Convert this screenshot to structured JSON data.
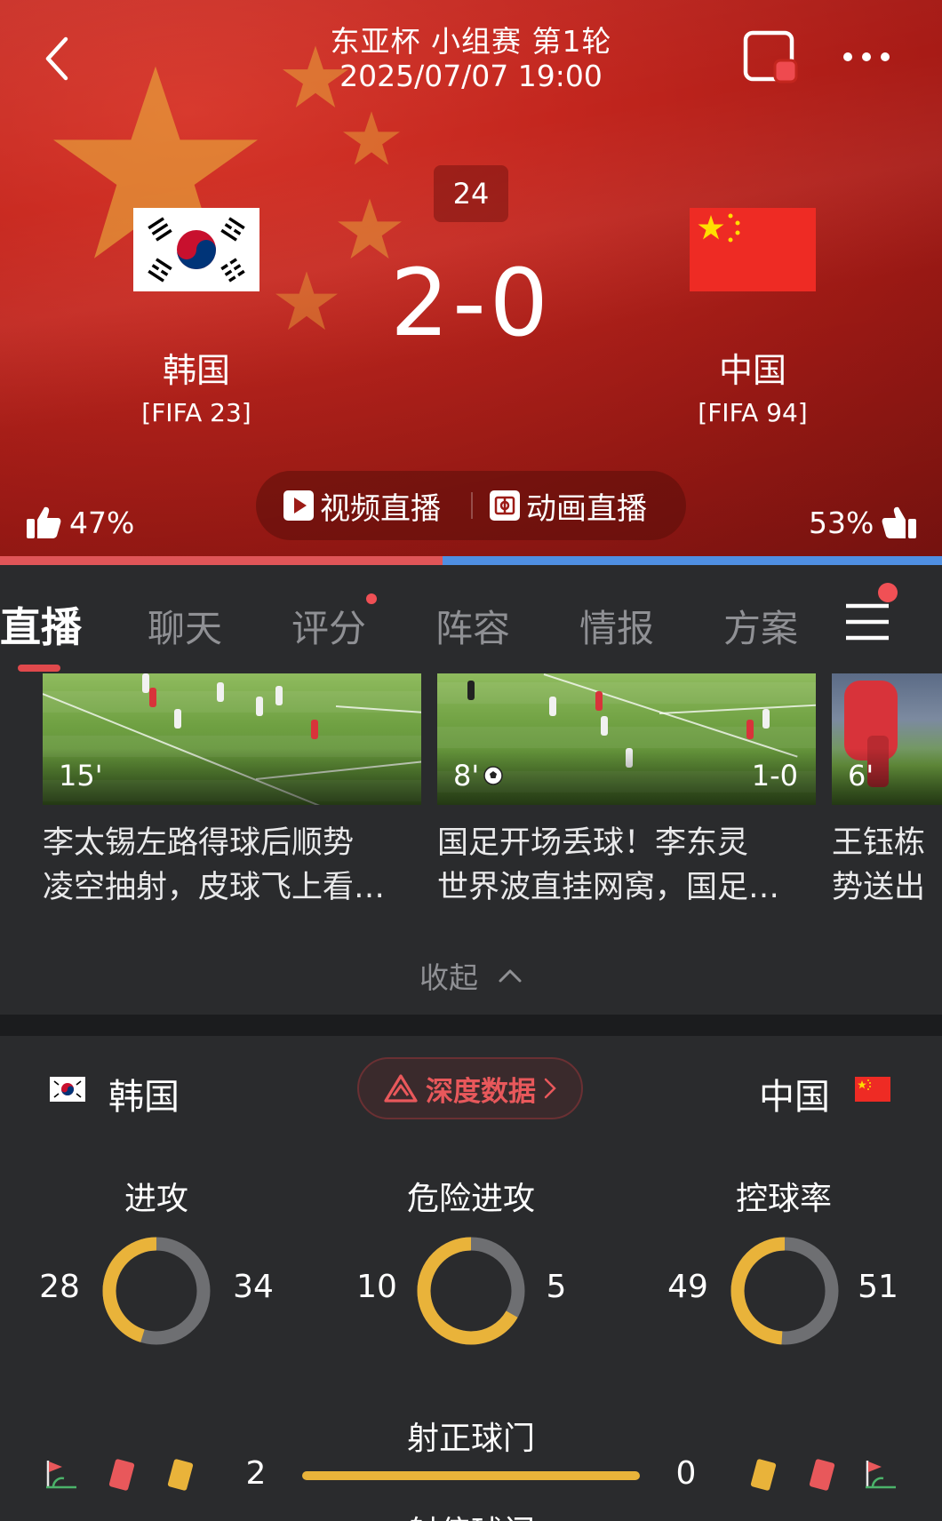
{
  "header": {
    "title": "东亚杯 小组赛 第1轮",
    "datetime": "2025/07/07 19:00",
    "minute": "24",
    "score": "2-0",
    "home": {
      "name": "韩国",
      "fifa": "[FIFA 23]",
      "support": "47%"
    },
    "away": {
      "name": "中国",
      "fifa": "[FIFA 94]",
      "support": "53%"
    },
    "live_buttons": {
      "video": "视频直播",
      "animation": "动画直播"
    },
    "support_split": 0.47,
    "colors": {
      "home_bar": "#e05558",
      "away_bar": "#4f8fe2",
      "background": "#c3261e"
    }
  },
  "tabs": [
    {
      "label": "直播",
      "active": true
    },
    {
      "label": "聊天",
      "active": false
    },
    {
      "label": "评分",
      "active": false,
      "dot": true
    },
    {
      "label": "阵容",
      "active": false
    },
    {
      "label": "情报",
      "active": false
    },
    {
      "label": "方案",
      "active": false
    }
  ],
  "videos": [
    {
      "minute": "15'",
      "score": "",
      "line1": "李太锡左路得球后顺势",
      "line2": "凌空抽射，皮球飞上看…"
    },
    {
      "minute": "8'",
      "score": "1-0",
      "line1": "国足开场丢球！李东灵",
      "line2": "世界波直挂网窝，国足…"
    },
    {
      "minute": "6'",
      "score": "",
      "line1": "王钰栋",
      "line2": "势送出"
    }
  ],
  "collapse_label": "收起",
  "stats": {
    "home_name": "韩国",
    "away_name": "中国",
    "deep_data_label": "深度数据",
    "metrics": [
      {
        "label": "进攻",
        "home": "28",
        "away": "34",
        "home_share": 0.452
      },
      {
        "label": "危险进攻",
        "home": "10",
        "away": "5",
        "home_share": 0.667
      },
      {
        "label": "控球率",
        "home": "49",
        "away": "51",
        "home_share": 0.49
      }
    ],
    "shots_on_target": {
      "label": "射正球门",
      "home": "2",
      "away": "0"
    },
    "next_label": "射偏球门",
    "colors": {
      "home_ring": "#e9b33a",
      "away_ring": "#6e6f72"
    }
  }
}
